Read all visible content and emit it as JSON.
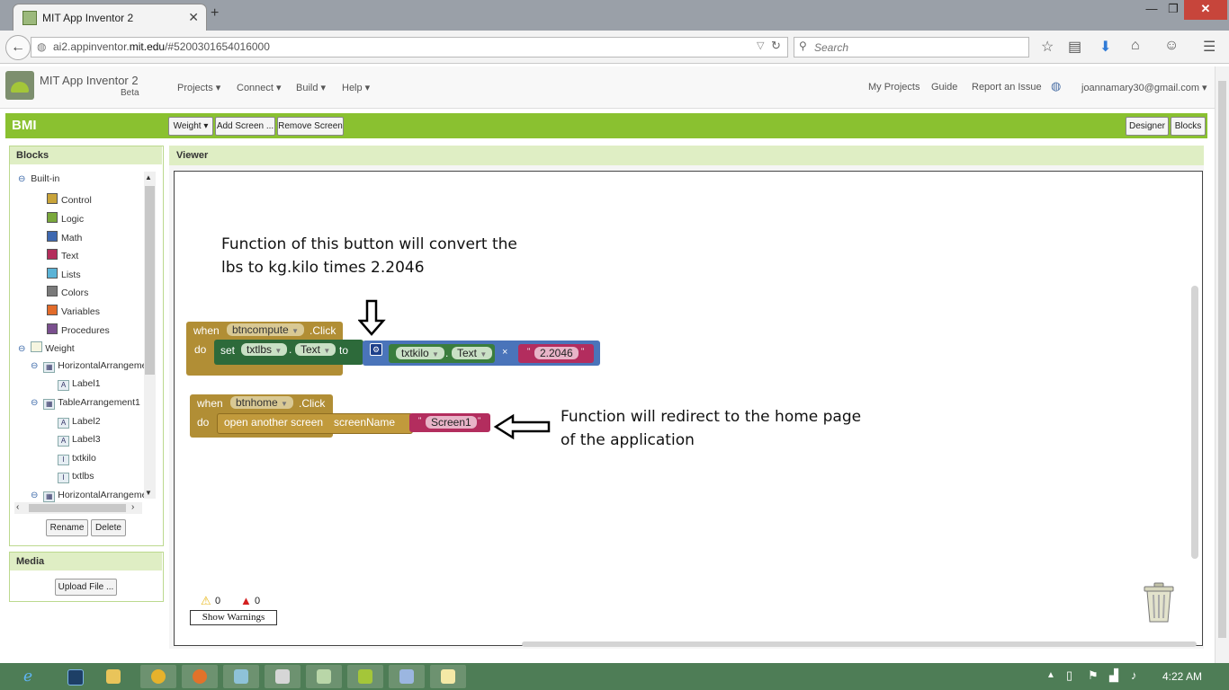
{
  "browser": {
    "tab_title": "MIT App Inventor 2",
    "url_plain_prefix": "ai2.appinventor.",
    "url_domain": "mit.edu",
    "url_suffix": "/#5200301654016000",
    "search_placeholder": "Search"
  },
  "app_header": {
    "name": "MIT App Inventor 2",
    "beta": "Beta",
    "menus": [
      "Projects ▾",
      "Connect ▾",
      "Build ▾",
      "Help ▾"
    ],
    "links": [
      "My Projects",
      "Guide",
      "Report an Issue"
    ],
    "user": "joannamary30@gmail.com ▾"
  },
  "project_bar": {
    "project": "BMI",
    "screen_dropdown": "Weight ▾",
    "add_screen": "Add Screen ...",
    "remove_screen": "Remove Screen",
    "designer": "Designer",
    "blocks": "Blocks"
  },
  "blocks_panel": {
    "title": "Blocks",
    "builtin": "Built-in",
    "builtin_items": [
      {
        "label": "Control",
        "color": "#c9a43a"
      },
      {
        "label": "Logic",
        "color": "#7aa83c"
      },
      {
        "label": "Math",
        "color": "#3e68b0"
      },
      {
        "label": "Text",
        "color": "#b42e5c"
      },
      {
        "label": "Lists",
        "color": "#5bb3d6"
      },
      {
        "label": "Colors",
        "color": "#7a7a7a"
      },
      {
        "label": "Variables",
        "color": "#e26b2a"
      },
      {
        "label": "Procedures",
        "color": "#7a4f8e"
      }
    ],
    "screen": "Weight",
    "components": [
      "HorizontalArrangeme",
      "Label1",
      "TableArrangement1",
      "Label2",
      "Label3",
      "txtkilo",
      "txtlbs",
      "HorizontalArrangeme"
    ],
    "rename": "Rename",
    "delete": "Delete"
  },
  "media_panel": {
    "title": "Media",
    "upload": "Upload File ..."
  },
  "viewer": {
    "title": "Viewer",
    "note1_line1": "Function of this button will convert the",
    "note1_line2": "lbs to kg.kilo times 2.2046",
    "note2_line1": "Function will redirect to the home page",
    "note2_line2": "of the application",
    "block1": {
      "when": "when",
      "component": "btncompute",
      "event": ".Click",
      "do": "do",
      "set": "set",
      "target": "txtlbs",
      "dot": ".",
      "prop": "Text",
      "to": "to",
      "operand_component": "txtkilo",
      "operand_prop": "Text",
      "operator": "×",
      "number": "2.2046"
    },
    "block2": {
      "when": "when",
      "component": "btnhome",
      "event": ".Click",
      "do": "do",
      "action": "open another screen",
      "param": "screenName",
      "value": "Screen1"
    },
    "warnings_count": "0",
    "errors_count": "0",
    "show_warnings": "Show Warnings"
  },
  "taskbar": {
    "time": "4:22 AM"
  }
}
